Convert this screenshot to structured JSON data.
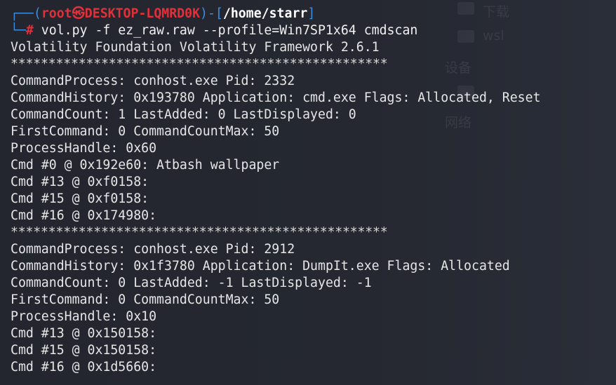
{
  "prompt": {
    "corner_top": "┌──(",
    "user": "root㉿DESKTOP-LQMRD0K",
    "sep": ")-[",
    "path": "/home/starr",
    "close": "]",
    "corner_bottom": "└─",
    "hash": "#",
    "command": " vol.py -f ez_raw.raw --profile=Win7SP1x64 cmdscan"
  },
  "output": [
    "Volatility Foundation Volatility Framework 2.6.1",
    "**************************************************",
    "CommandProcess: conhost.exe Pid: 2332",
    "CommandHistory: 0x193780 Application: cmd.exe Flags: Allocated, Reset",
    "CommandCount: 1 LastAdded: 0 LastDisplayed: 0",
    "FirstCommand: 0 CommandCountMax: 50",
    "ProcessHandle: 0x60",
    "Cmd #0 @ 0x192e60: Atbash wallpaper",
    "Cmd #13 @ 0xf0158:",
    "Cmd #15 @ 0xf0158:",
    "Cmd #16 @ 0x174980:",
    "**************************************************",
    "CommandProcess: conhost.exe Pid: 2912",
    "CommandHistory: 0x1f3780 Application: DumpIt.exe Flags: Allocated",
    "CommandCount: 0 LastAdded: -1 LastDisplayed: -1",
    "FirstCommand: 0 CommandCountMax: 50",
    "ProcessHandle: 0x10",
    "Cmd #13 @ 0x150158:",
    "Cmd #15 @ 0x150158:",
    "Cmd #16 @ 0x1d5660:"
  ],
  "background": {
    "item1": "下载",
    "item2": "wsl",
    "item3": "设备",
    "item4": "网络"
  }
}
